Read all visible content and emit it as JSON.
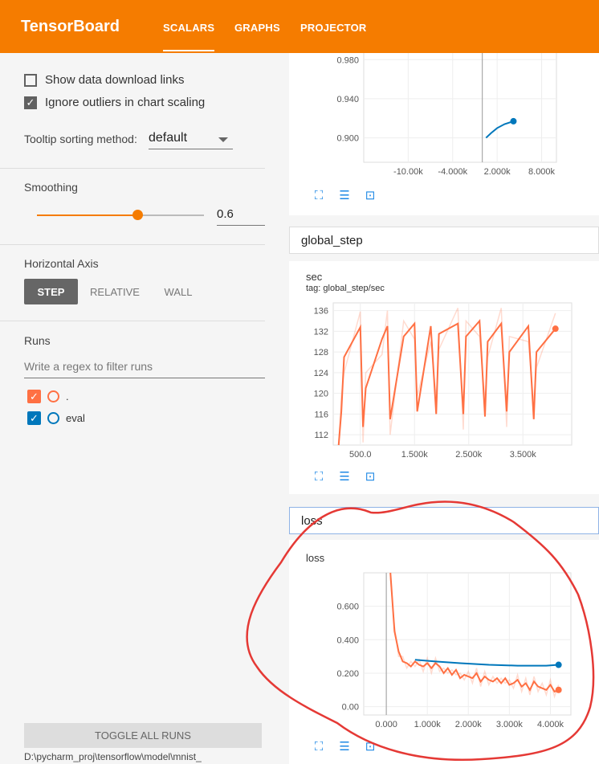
{
  "app_title": "TensorBoard",
  "tabs": [
    {
      "label": "SCALARS",
      "active": true
    },
    {
      "label": "GRAPHS",
      "active": false
    },
    {
      "label": "PROJECTOR",
      "active": false
    }
  ],
  "sidebar": {
    "show_download_links": {
      "label": "Show data download links",
      "checked": false
    },
    "ignore_outliers": {
      "label": "Ignore outliers in chart scaling",
      "checked": true
    },
    "tooltip_sorting": {
      "label": "Tooltip sorting method:",
      "value": "default"
    },
    "smoothing": {
      "label": "Smoothing",
      "value": "0.6",
      "level": 0.6
    },
    "horizontal_axis": {
      "label": "Horizontal Axis",
      "options": [
        "STEP",
        "RELATIVE",
        "WALL"
      ],
      "selected": "STEP"
    },
    "runs": {
      "label": "Runs",
      "filter_placeholder": "Write a regex to filter runs",
      "items": [
        {
          "name": ".",
          "checked": true,
          "color": "#ff7043"
        },
        {
          "name": "eval",
          "checked": true,
          "color": "#0077bb"
        }
      ]
    },
    "toggle_all": "TOGGLE ALL RUNS",
    "log_dir": "D:\\pycharm_proj\\tensorflow\\model\\mnist_"
  },
  "groups": [
    {
      "name": "global_step"
    },
    {
      "name": "loss"
    }
  ],
  "colors": {
    "accent": "#f57c00",
    "run_train": "#ff7043",
    "run_eval": "#0077bb",
    "tool_blue": "#1e88e5",
    "annotation_red": "#e53935"
  },
  "icons": [
    "fit-to-screen-icon",
    "toggle-log-scale-icon",
    "fit-domain-icon"
  ],
  "chart_data": [
    {
      "type": "line",
      "title": "",
      "x_ticks": [
        "-10.00k",
        "-4.000k",
        "2.000k",
        "8.000k"
      ],
      "y_ticks": [
        "0.900",
        "0.940",
        "0.980"
      ],
      "series": [
        {
          "name": "eval",
          "x": [
            500,
            1200,
            2000,
            3000,
            4200
          ],
          "y": [
            0.9,
            0.905,
            0.91,
            0.914,
            0.917
          ]
        }
      ]
    },
    {
      "type": "line",
      "title": "sec",
      "tag": "tag: global_step/sec",
      "x_ticks": [
        "500.0",
        "1.500k",
        "2.500k",
        "3.500k"
      ],
      "y_ticks": [
        "112",
        "116",
        "120",
        "124",
        "128",
        "132",
        "136"
      ],
      "series": [
        {
          "name": ".",
          "x": [
            100,
            150,
            200,
            500,
            550,
            600,
            900,
            1000,
            1050,
            1300,
            1500,
            1550,
            1800,
            1900,
            1950,
            2300,
            2400,
            2450,
            2700,
            2800,
            2850,
            3100,
            3200,
            3250,
            3600,
            3700,
            3750,
            4100
          ],
          "y": [
            110,
            116.5,
            127,
            132.8,
            113.5,
            121,
            130.5,
            133,
            115,
            131,
            133.5,
            116.5,
            133,
            116,
            131.5,
            133.5,
            116,
            131,
            134,
            115.5,
            130,
            133.5,
            116.5,
            128,
            133,
            115,
            128,
            132.5
          ]
        }
      ]
    },
    {
      "type": "line",
      "title": "loss",
      "x_ticks": [
        "0.000",
        "1.000k",
        "2.000k",
        "3.000k",
        "4.000k"
      ],
      "y_ticks": [
        "0.00",
        "0.200",
        "0.400",
        "0.600"
      ],
      "series": [
        {
          "name": ".",
          "x": [
            100,
            200,
            300,
            400,
            500,
            600,
            700,
            800,
            900,
            1000,
            1100,
            1200,
            1300,
            1400,
            1500,
            1600,
            1700,
            1800,
            1900,
            2000,
            2100,
            2200,
            2300,
            2400,
            2500,
            2600,
            2700,
            2800,
            2900,
            3000,
            3100,
            3200,
            3300,
            3400,
            3500,
            3600,
            3700,
            3800,
            3900,
            4000,
            4100,
            4200
          ],
          "y": [
            0.8,
            0.45,
            0.33,
            0.27,
            0.26,
            0.24,
            0.27,
            0.25,
            0.24,
            0.26,
            0.23,
            0.26,
            0.24,
            0.2,
            0.23,
            0.19,
            0.22,
            0.17,
            0.19,
            0.18,
            0.17,
            0.2,
            0.15,
            0.18,
            0.16,
            0.15,
            0.17,
            0.14,
            0.17,
            0.13,
            0.14,
            0.16,
            0.12,
            0.14,
            0.1,
            0.15,
            0.12,
            0.11,
            0.1,
            0.13,
            0.09,
            0.1
          ]
        },
        {
          "name": "eval",
          "x": [
            700,
            1200,
            1800,
            2500,
            3200,
            3900,
            4200
          ],
          "y": [
            0.28,
            0.27,
            0.26,
            0.25,
            0.245,
            0.245,
            0.25
          ]
        }
      ]
    }
  ]
}
